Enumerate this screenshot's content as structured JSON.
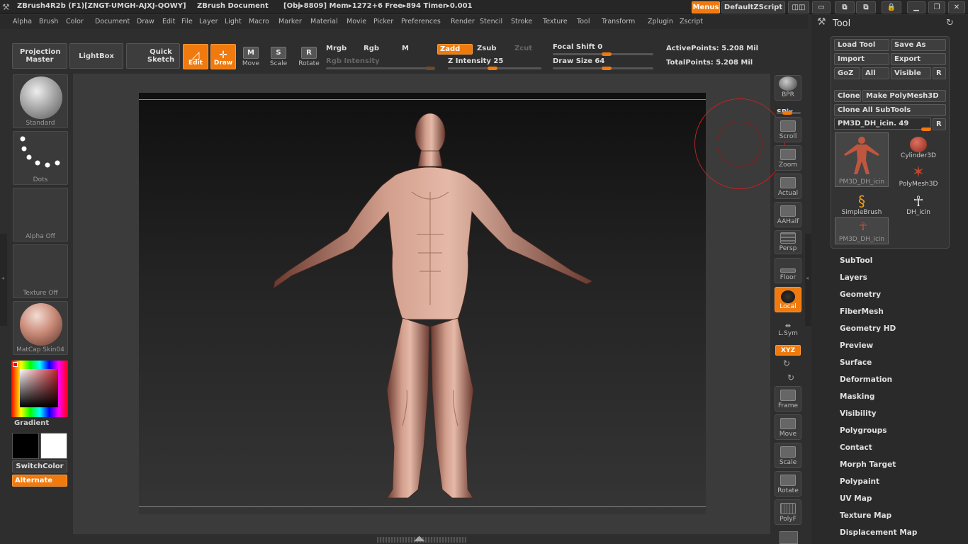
{
  "titlebar": {
    "app": "ZBrush4R2b (F1)[ZNGT-UMGH-AJXJ-QOWY]",
    "document": "ZBrush Document",
    "stats": "[Obj▸8809] Mem▸1272+6 Free▸894 Timer▸0.001",
    "menus_btn": "Menus",
    "zscript_btn": "DefaultZScript"
  },
  "menubar": [
    "Alpha",
    "Brush",
    "Color",
    "Document",
    "Draw",
    "Edit",
    "File",
    "Layer",
    "Light",
    "Macro",
    "Marker",
    "Material",
    "Movie",
    "Picker",
    "Preferences",
    "Render",
    "Stencil",
    "Stroke",
    "Texture",
    "Tool",
    "Transform",
    "Zplugin",
    "Zscript"
  ],
  "shelf": {
    "projection_master": "Projection Master",
    "lightbox": "LightBox",
    "quick_sketch": "Quick Sketch",
    "edit": "Edit",
    "draw": "Draw",
    "move": "Move",
    "scale": "Scale",
    "rotate": "Rotate",
    "mrgb": "Mrgb",
    "rgb": "Rgb",
    "m": "M",
    "zadd": "Zadd",
    "zsub": "Zsub",
    "zcut": "Zcut",
    "rgb_intensity": "Rgb Intensity",
    "z_intensity": "Z Intensity 25",
    "focal_shift": "Focal Shift 0",
    "draw_size": "Draw Size 64",
    "active_points": "ActivePoints: 5.208 Mil",
    "total_points": "TotalPoints: 5.208 Mil"
  },
  "left_tray": {
    "brush": "Standard",
    "stroke": "Dots",
    "alpha": "Alpha  Off",
    "texture": "Texture  Off",
    "material": "MatCap  Skin04",
    "gradient": "Gradient",
    "switch_color": "SwitchColor",
    "alternate": "Alternate"
  },
  "right_shelf": [
    "BPR",
    "SPix",
    "Scroll",
    "Zoom",
    "Actual",
    "AAHalf",
    "Persp",
    "Floor",
    "Local",
    "L.Sym",
    "XYZ",
    "Frame",
    "Move",
    "Scale",
    "Rotate",
    "PolyF"
  ],
  "tool_panel": {
    "title": "Tool",
    "load_tool": "Load Tool",
    "save_as": "Save As",
    "import": "Import",
    "export": "Export",
    "goz": "GoZ",
    "all": "All",
    "visible": "Visible",
    "r": "R",
    "clone": "Clone",
    "make_polymesh": "Make PolyMesh3D",
    "clone_all": "Clone  All  SubTools",
    "current_tool": "PM3D_DH_icin. 49",
    "thumbs": [
      "PM3D_DH_icin",
      "Cylinder3D",
      "PolyMesh3D",
      "SimpleBrush",
      "DH_icin",
      "PM3D_DH_icin"
    ],
    "sections": [
      "SubTool",
      "Layers",
      "Geometry",
      "FiberMesh",
      "Geometry HD",
      "Preview",
      "Surface",
      "Deformation",
      "Masking",
      "Visibility",
      "Polygroups",
      "Contact",
      "Morph Target",
      "Polypaint",
      "UV Map",
      "Texture Map",
      "Displacement Map"
    ]
  },
  "colors": {
    "accent": "#f07a0e",
    "skin": "#c98a78"
  }
}
